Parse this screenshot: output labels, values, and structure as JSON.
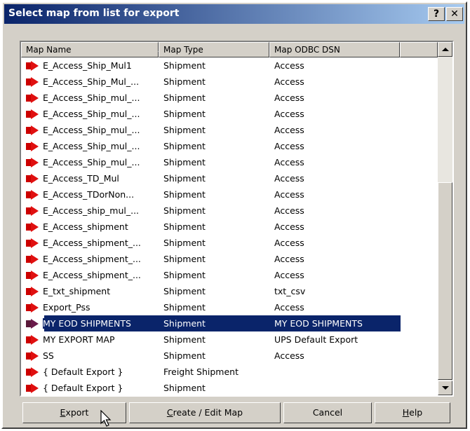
{
  "dialog": {
    "title": "Select map from list for export",
    "help_button": "?",
    "close_button": "✕"
  },
  "listview": {
    "columns": [
      "Map Name",
      "Map Type",
      "Map ODBC DSN"
    ],
    "rows": [
      {
        "name": "E_Access_Ship_Mul1",
        "type": "Shipment",
        "dsn": "Access"
      },
      {
        "name": "E_Access_Ship_Mul_...",
        "type": "Shipment",
        "dsn": "Access"
      },
      {
        "name": "E_Access_Ship_mul_...",
        "type": "Shipment",
        "dsn": "Access"
      },
      {
        "name": "E_Access_Ship_mul_...",
        "type": "Shipment",
        "dsn": "Access"
      },
      {
        "name": "E_Access_Ship_mul_...",
        "type": "Shipment",
        "dsn": "Access"
      },
      {
        "name": "E_Access_Ship_mul_...",
        "type": "Shipment",
        "dsn": "Access"
      },
      {
        "name": "E_Access_Ship_mul_...",
        "type": "Shipment",
        "dsn": "Access"
      },
      {
        "name": "E_Access_TD_Mul",
        "type": "Shipment",
        "dsn": "Access"
      },
      {
        "name": "E_Access_TDorNon...",
        "type": "Shipment",
        "dsn": "Access"
      },
      {
        "name": "E_Access_ship_mul_...",
        "type": "Shipment",
        "dsn": "Access"
      },
      {
        "name": "E_Access_shipment",
        "type": "Shipment",
        "dsn": "Access"
      },
      {
        "name": "E_Access_shipment_...",
        "type": "Shipment",
        "dsn": "Access"
      },
      {
        "name": "E_Access_shipment_...",
        "type": "Shipment",
        "dsn": "Access"
      },
      {
        "name": "E_Access_shipment_...",
        "type": "Shipment",
        "dsn": "Access"
      },
      {
        "name": "E_txt_shipment",
        "type": "Shipment",
        "dsn": "txt_csv"
      },
      {
        "name": "Export_Pss",
        "type": "Shipment",
        "dsn": "Access"
      },
      {
        "name": "MY EOD SHIPMENTS",
        "type": "Shipment",
        "dsn": "MY EOD SHIPMENTS",
        "selected": true
      },
      {
        "name": "MY EXPORT MAP",
        "type": "Shipment",
        "dsn": "UPS Default Export"
      },
      {
        "name": "SS",
        "type": "Shipment",
        "dsn": "Access"
      },
      {
        "name": "{ Default Export }",
        "type": "Freight Shipment",
        "dsn": ""
      },
      {
        "name": "{ Default Export }",
        "type": "Shipment",
        "dsn": ""
      }
    ]
  },
  "buttons": {
    "export": "Export",
    "create_edit": "Create / Edit Map",
    "cancel": "Cancel",
    "help": "Help"
  },
  "icons": {
    "row_icon": "export-map-icon"
  },
  "colors": {
    "title_bar": "#0a246a",
    "selection": "#0a246a",
    "face": "#d4d0c8"
  }
}
